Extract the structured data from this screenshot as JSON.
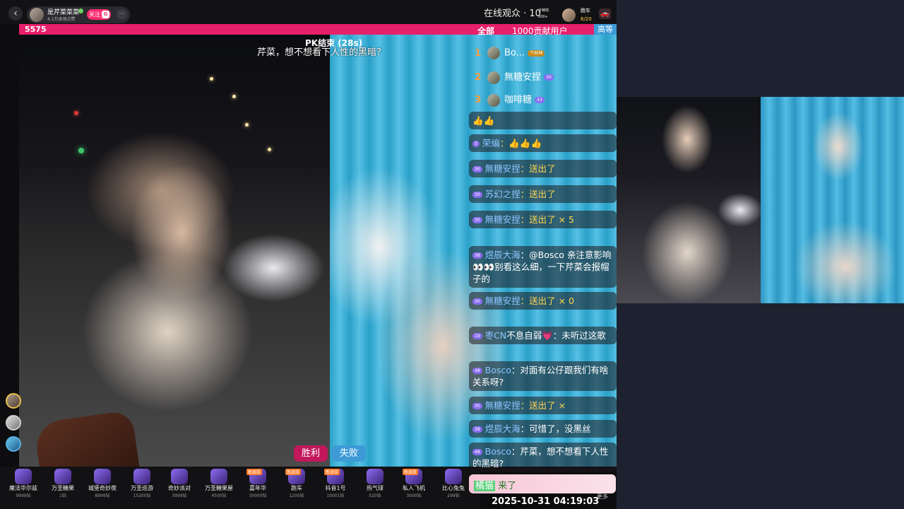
{
  "header": {
    "back_icon": "chevron-left-icon",
    "host_name": "是芹菜菜菜",
    "host_sub": "4.1万本场点赞",
    "follow_label": "关注",
    "follow_badge": "G",
    "more_label": "···",
    "viewers_label": "在线观众 · 10",
    "rank_badge_top": "分钟前",
    "rank_badge_bottom": "100+",
    "race_label": "跑车",
    "race_progress": "6/20"
  },
  "pk": {
    "score": "5575",
    "end_text": "PK结束 (28s)",
    "overlay_comment": "芹菜，想不想看下人性的黑暗？",
    "win_label": "胜利",
    "lose_label": "失败"
  },
  "chat_tabs": {
    "all": "全部",
    "contrib": "1000贡献用户",
    "high": "高等"
  },
  "ranking": [
    {
      "rank": "1",
      "name": "Bo...",
      "badge": "个财神"
    },
    {
      "rank": "2",
      "name": "無糖安捏",
      "badge": "30"
    },
    {
      "rank": "3",
      "name": "咖啡糖",
      "badge": "43"
    }
  ],
  "chat": [
    {
      "level": "",
      "user": "",
      "text": "👍👍"
    },
    {
      "level": "3",
      "user": "荣编",
      "text": "：👍👍👍"
    },
    {
      "level": "30",
      "user": "無糖安捏",
      "text": "：送出了"
    },
    {
      "level": "30",
      "user": "苏幻之捏",
      "text": "：送出了"
    },
    {
      "level": "30",
      "user": "無糖安捏",
      "text": "：送出了 × 5"
    },
    {
      "level": "38",
      "user": "煜辰大海",
      "text": "：@Bosco 亲注意影响👀👀别看这么细，一下芹菜会报帽子的"
    },
    {
      "level": "30",
      "user": "無糖安捏",
      "text": "：送出了 × 0"
    },
    {
      "level": "19",
      "user": "枣CN",
      "text": "不息自弱💗：未听过这歌"
    },
    {
      "level": "48",
      "user": "Bosco",
      "text": "：对面有公仔跟我们有啥关系呀?"
    },
    {
      "level": "30",
      "user": "無糖安捏",
      "text": "：送出了 ×"
    },
    {
      "level": "38",
      "user": "煜辰大海",
      "text": "：可惜了，没黑丝"
    },
    {
      "level": "48",
      "user": "Bosco",
      "text": "：芹菜，想不想看下人性的黑暗?"
    }
  ],
  "join": {
    "name": "橘猫",
    "action": "来了"
  },
  "timestamp": "2025-10-31 04:19:03",
  "more_gifts": "更多",
  "gifts": [
    {
      "name": "魔法华尔兹",
      "price": "9999钻",
      "tag": ""
    },
    {
      "name": "万圣糖果",
      "price": "1钻",
      "tag": ""
    },
    {
      "name": "城堡奇妙夜",
      "price": "8999钻",
      "tag": ""
    },
    {
      "name": "万圣巡游",
      "price": "15200钻",
      "tag": ""
    },
    {
      "name": "奇妙派对",
      "price": "3999钻",
      "tag": ""
    },
    {
      "name": "万圣糖果屋",
      "price": "4500钻",
      "tag": ""
    },
    {
      "name": "嘉年华",
      "price": "30000钻",
      "tag": "新皮肤"
    },
    {
      "name": "跑车",
      "price": "1200钻",
      "tag": "新皮肤"
    },
    {
      "name": "抖音1号",
      "price": "10001钻",
      "tag": "新皮肤"
    },
    {
      "name": "热气球",
      "price": "520钻",
      "tag": ""
    },
    {
      "name": "私人飞机",
      "price": "3000钻",
      "tag": "新皮肤"
    },
    {
      "name": "比心兔兔",
      "price": "299钻",
      "tag": ""
    }
  ],
  "colors": {
    "pk_bar": "#e8206b",
    "win": "#c2185b",
    "lose": "#3d9ad6",
    "accent": "#ff2d6f"
  }
}
